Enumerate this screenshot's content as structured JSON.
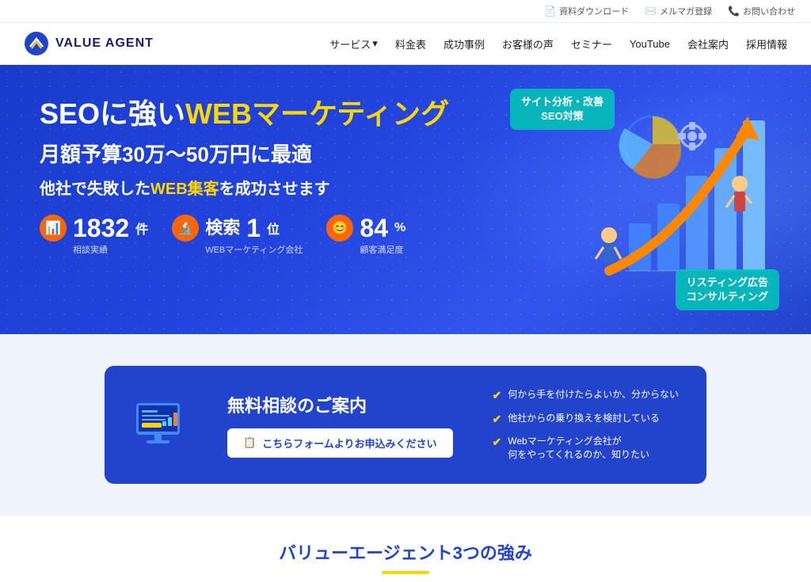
{
  "topbar": {
    "items": [
      {
        "label": "資料ダウンロード",
        "icon": "📄"
      },
      {
        "label": "メルマガ登録",
        "icon": "✉️"
      },
      {
        "label": "お問い合わせ",
        "icon": "📞"
      }
    ]
  },
  "header": {
    "logo_text": "VALUE AGENT",
    "nav_items": [
      {
        "label": "サービス",
        "has_arrow": true
      },
      {
        "label": "料金表"
      },
      {
        "label": "成功事例"
      },
      {
        "label": "お客様の声"
      },
      {
        "label": "セミナー"
      },
      {
        "label": "YouTube"
      },
      {
        "label": "会社案内"
      },
      {
        "label": "採用情報"
      }
    ]
  },
  "hero": {
    "title_part1": "SEOに強い",
    "title_part2": "WEBマーケティング",
    "subtitle": "月額予算30万〜50万円に最適",
    "sub2": "他社で失敗した",
    "sub2b": "WEB集客",
    "sub2c": "を成功させます",
    "stats": [
      {
        "number": "1832",
        "unit": "件",
        "label": "相談実績",
        "icon": "📊"
      },
      {
        "number": "検索1位",
        "unit": "",
        "label": "WEBマーケティング会社",
        "icon": "🔬"
      },
      {
        "number": "84",
        "unit": "%",
        "label": "顧客満足度",
        "icon": "😊"
      }
    ],
    "tag1_line1": "サイト分析・改善",
    "tag1_line2": "SEO対策",
    "tag2_line1": "リスティング広告",
    "tag2_line2": "コンサルティング"
  },
  "consult": {
    "title": "無料相談のご案内",
    "btn_label": "こちらフォームよりお申込みください",
    "checks": [
      "何から手を付けたらよいか、分からない",
      "他社からの乗り換えを検討している",
      "Webマーケティング会社が\n何をやってくれるのか、知りたい"
    ]
  },
  "strengths": {
    "title": "バリューエージェント3つの強み"
  }
}
